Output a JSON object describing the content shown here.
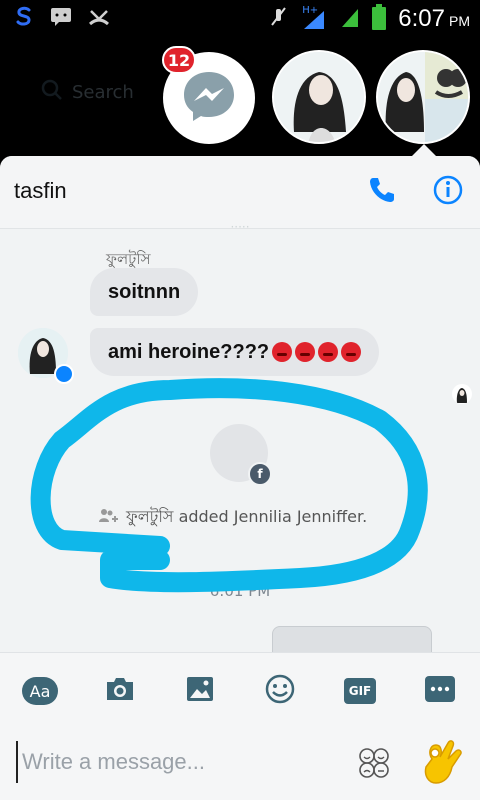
{
  "status_bar": {
    "time": "6:07",
    "ampm": "PM",
    "network": "H+"
  },
  "chat_heads": {
    "search_placeholder": "Search",
    "messenger_badge": "12"
  },
  "header": {
    "title": "tasfin"
  },
  "conversation": {
    "sender_name": "ফুলটুসি",
    "messages": [
      {
        "text": "soitnnn"
      },
      {
        "text": "ami heroine????"
      }
    ],
    "system_event": "ফুলটুসি added Jennilia Jenniffer.",
    "timestamp": "6:01 PM"
  },
  "composer": {
    "tools": [
      "aa-icon",
      "camera-icon",
      "image-icon",
      "emoji-icon",
      "gif-icon",
      "more-icon"
    ],
    "aa_label": "Aa",
    "gif_label": "GIF",
    "input_placeholder": "Write a message..."
  },
  "colors": {
    "accent": "#0b84ff",
    "toolbar_icon": "#3d6676",
    "badge": "#e0232c",
    "scribble": "#0fb7ea"
  }
}
